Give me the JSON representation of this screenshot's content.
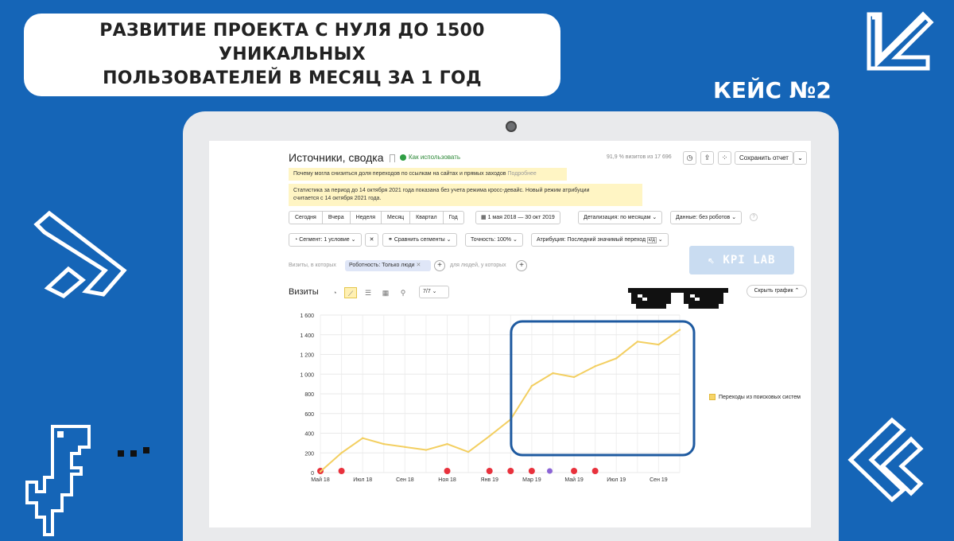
{
  "headline": {
    "line1": "РАЗВИТИЕ ПРОЕКТА С НУЛЯ ДО 1500 УНИКАЛЬНЫХ",
    "line2": "ПОЛЬЗОВАТЕЛЕЙ В МЕСЯЦ ЗА 1 ГОД"
  },
  "case_label": "КЕЙС №2",
  "colors": {
    "background": "#1565b7",
    "line": "#f3cf61",
    "highlight_frame": "#1e5aa0",
    "event_marker": "#e8313c"
  },
  "report": {
    "title": "Источники, сводка",
    "how_to_use": "Как использовать",
    "visits_share": "91,9 % визитов из 17 696",
    "save_button": "Сохранить отчет",
    "notice_1": "Почему могла снизиться доля переходов по ссылкам на сайтах и прямых заходов",
    "notice_1_link": "Подробнее",
    "notice_2_line1": "Статистика за период до 14 октября 2021 года показана без учета режима кросс-девайс. Новый режим атрибуции",
    "notice_2_line2": "считается с 14 октября 2021 года.",
    "periods": [
      "Сегодня",
      "Вчера",
      "Неделя",
      "Месяц",
      "Квартал",
      "Год"
    ],
    "date_range": "1 мая 2018 — 30 окт 2019",
    "detail": "Детализация: по месяцам",
    "data_mode": "Данные: без роботов",
    "segment": "Сегмент: 1 условие",
    "compare": "Сравнить сегменты",
    "accuracy": "Точность: 100%",
    "attribution": "Атрибуция: Последний значимый переход",
    "attribution_tag": "к/д",
    "filter_prefix": "Визиты, в которых",
    "filter_chip": "Роботность: Только люди",
    "filter_suffix": "для людей, у которых",
    "chart_title": "Визиты",
    "series_count": "7/7",
    "hide_chart": "Скрыть график"
  },
  "kpi_logo": "KPI LAB",
  "chart_data": {
    "type": "line",
    "title": "Визиты",
    "x": [
      "Май 18",
      "Июн 18",
      "Июл 18",
      "Авг 18",
      "Сен 18",
      "Окт 18",
      "Ноя 18",
      "Дек 18",
      "Янв 19",
      "Фев 19",
      "Мар 19",
      "Апр 19",
      "Май 19",
      "Июн 19",
      "Июл 19",
      "Авг 19",
      "Сен 19",
      "Окт 19"
    ],
    "x_tick_labels": [
      "Май 18",
      "Июл 18",
      "Сен 18",
      "Ноя 18",
      "Янв 19",
      "Мар 19",
      "Май 19",
      "Июл 19",
      "Сен 19"
    ],
    "y_ticks": [
      0,
      200,
      400,
      600,
      800,
      1000,
      1200,
      1400,
      1600
    ],
    "ylim": [
      0,
      1600
    ],
    "series": [
      {
        "name": "Переходы из поисковых систем",
        "values": [
          10,
          200,
          350,
          290,
          260,
          230,
          290,
          210,
          370,
          540,
          880,
          1010,
          970,
          1080,
          1160,
          1330,
          1300,
          1450
        ]
      }
    ],
    "legend_position": "right",
    "grid": true,
    "highlight_range": [
      "Мар 19",
      "Окт 19"
    ]
  }
}
